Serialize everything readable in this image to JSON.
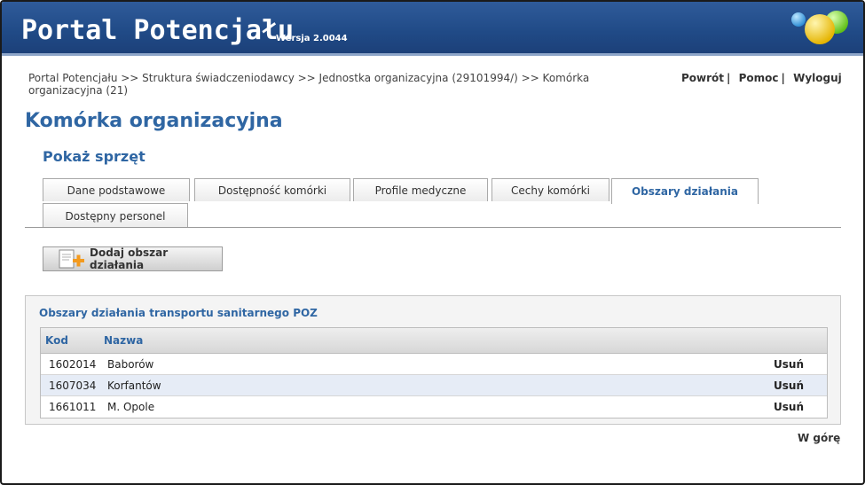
{
  "header": {
    "title": "Portal Potencjału",
    "version": "Wersja 2.0044"
  },
  "breadcrumb": "Portal Potencjału >> Struktura świadczeniodawcy >> Jednostka organizacyjna (29101994/) >> Komórka organizacyjna (21)",
  "toplinks": {
    "back": "Powrót",
    "help": "Pomoc",
    "logout": "Wyloguj",
    "sep": "|"
  },
  "page_title": "Komórka organizacyjna",
  "subtitle": "Pokaż sprzęt",
  "tabs": [
    {
      "label": "Dane podstawowe"
    },
    {
      "label": "Dostępność komórki"
    },
    {
      "label": "Profile medyczne"
    },
    {
      "label": "Cechy komórki"
    },
    {
      "label": "Obszary działania"
    },
    {
      "label": "Dostępny personel"
    }
  ],
  "add_button": {
    "label": "Dodaj obszar działania"
  },
  "panel": {
    "title": "Obszary działania transportu sanitarnego POZ",
    "columns": {
      "code": "Kod",
      "name": "Nazwa"
    },
    "rows": [
      {
        "code": "1602014",
        "name": "Baborów",
        "action": "Usuń"
      },
      {
        "code": "1607034",
        "name": "Korfantów",
        "action": "Usuń"
      },
      {
        "code": "1661011",
        "name": "M. Opole",
        "action": "Usuń"
      }
    ]
  },
  "scroll_up": "W górę",
  "colors": {
    "header_blue": "#204a86",
    "accent_blue": "#2f66a3",
    "row_highlight": "#e6ecf6"
  }
}
